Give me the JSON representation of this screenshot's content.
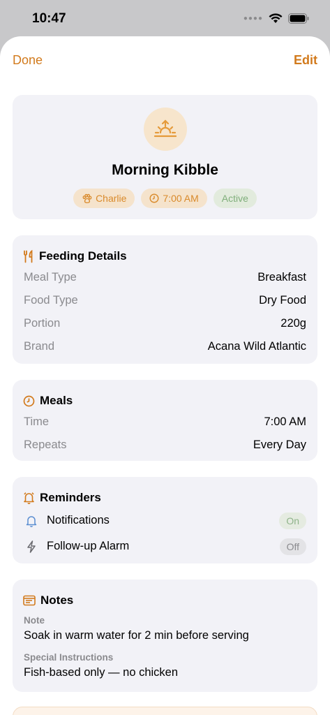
{
  "status_bar": {
    "time": "10:47"
  },
  "nav": {
    "done_label": "Done",
    "edit_label": "Edit"
  },
  "hero": {
    "title": "Morning Kibble",
    "icon": "sunrise-icon",
    "chips": {
      "pet": "Charlie",
      "time": "7:00 AM",
      "status": "Active"
    }
  },
  "feeding_details": {
    "title": "Feeding Details",
    "rows": [
      {
        "label": "Meal Type",
        "value": "Breakfast"
      },
      {
        "label": "Food Type",
        "value": "Dry Food"
      },
      {
        "label": "Portion",
        "value": "220g"
      },
      {
        "label": "Brand",
        "value": "Acana Wild Atlantic"
      }
    ]
  },
  "meals": {
    "title": "Meals",
    "rows": [
      {
        "label": "Time",
        "value": "7:00 AM"
      },
      {
        "label": "Repeats",
        "value": "Every Day"
      }
    ]
  },
  "reminders": {
    "title": "Reminders",
    "rows": [
      {
        "label": "Notifications",
        "value": "On"
      },
      {
        "label": "Follow-up Alarm",
        "value": "Off"
      }
    ]
  },
  "notes": {
    "title": "Notes",
    "note_label": "Note",
    "note_text": "Soak in warm water for 2 min before serving",
    "special_label": "Special Instructions",
    "special_text": "Fish-based only — no chicken"
  },
  "colors": {
    "accent": "#d27a1c",
    "card_bg": "#f2f2f7",
    "active_green": "#7fae7a"
  }
}
